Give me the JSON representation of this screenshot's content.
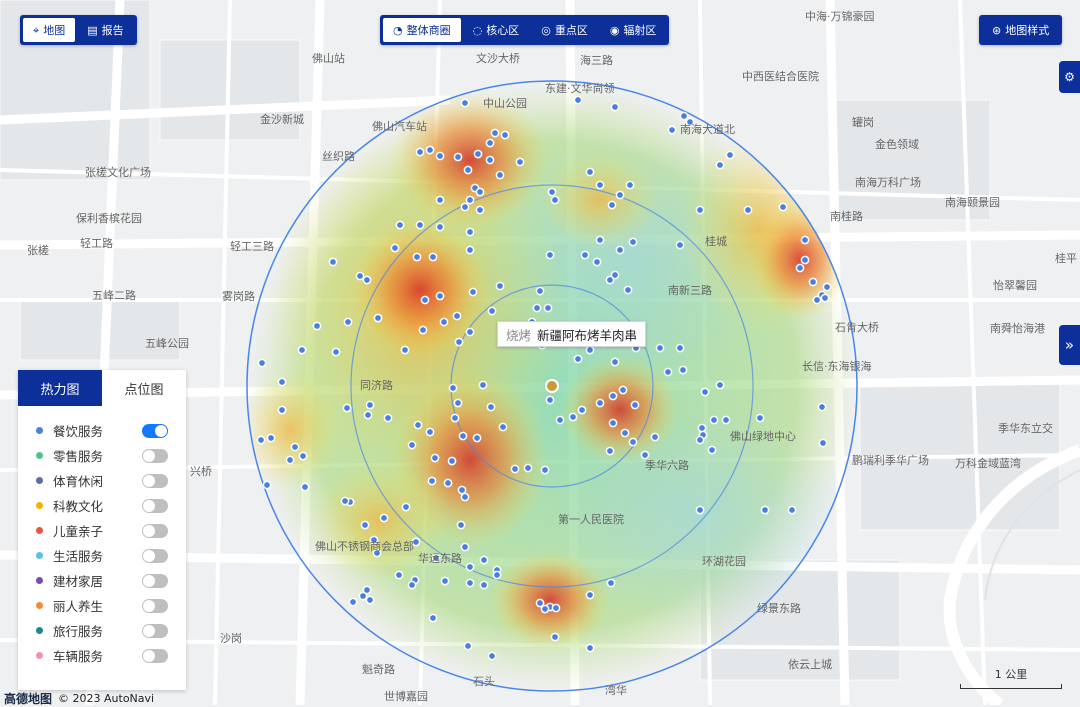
{
  "toolbar": {
    "mode_tabs": [
      {
        "label": "地图",
        "icon": "map-pin-icon"
      },
      {
        "label": "报告",
        "icon": "report-icon"
      }
    ],
    "circle_tabs": [
      {
        "label": "整体商圈",
        "icon": "ring-icon"
      },
      {
        "label": "核心区",
        "icon": "ring-icon"
      },
      {
        "label": "重点区",
        "icon": "target-icon"
      },
      {
        "label": "辐射区",
        "icon": "target-icon"
      }
    ],
    "map_style_label": "地图样式"
  },
  "panel": {
    "tabs": [
      "热力图",
      "点位图"
    ],
    "categories": [
      {
        "label": "餐饮服务",
        "color": "#4a7fe0",
        "on": true
      },
      {
        "label": "零售服务",
        "color": "#4fc08d",
        "on": false
      },
      {
        "label": "体育休闲",
        "color": "#5a6fa0",
        "on": false
      },
      {
        "label": "科教文化",
        "color": "#f0b400",
        "on": false
      },
      {
        "label": "儿童亲子",
        "color": "#e8573c",
        "on": false
      },
      {
        "label": "生活服务",
        "color": "#5bc0e6",
        "on": false
      },
      {
        "label": "建材家居",
        "color": "#7b4bb5",
        "on": false
      },
      {
        "label": "丽人养生",
        "color": "#f08a3c",
        "on": false
      },
      {
        "label": "旅行服务",
        "color": "#1a8a8a",
        "on": false
      },
      {
        "label": "车辆服务",
        "color": "#f28fb6",
        "on": false
      }
    ]
  },
  "popup": {
    "category": "烧烤",
    "name": "新疆阿布烤羊肉串"
  },
  "map_labels": [
    "中海·万锦豪园",
    "佛山站",
    "文沙大桥",
    "海三路",
    "东建·文华尚领",
    "中西医结合医院",
    "中山公园",
    "金沙新城",
    "佛山汽车站",
    "南海大道北",
    "罐岗",
    "金色领域",
    "丝织路",
    "张槎文化广场",
    "南海万科广场",
    "南海颐景园",
    "保利香槟花园",
    "南桂路",
    "张槎",
    "轻工路",
    "轻工三路",
    "桂城",
    "桂平",
    "五峰二路",
    "雾岗路",
    "南新三路",
    "怡翠馨园",
    "五峰公园",
    "石肯大桥",
    "南舜怡海港",
    "同济路",
    "长信·东海银海",
    "季华东立交",
    "佛山绿地中心",
    "鹏瑞利季华广场",
    "万科金域蓝湾",
    "季华六路",
    "第一人民医院",
    "环湖花园",
    "佛山不锈钢商会总部",
    "绿景东路",
    "依云上城",
    "魁奇路",
    "世博嘉园",
    "石头",
    "湾华",
    "华远东路",
    "兴桥",
    "沙岗"
  ],
  "attribution": {
    "logo": "高德地图",
    "copyright": "© 2023 AutoNavi"
  },
  "scale_label": "1 公里"
}
